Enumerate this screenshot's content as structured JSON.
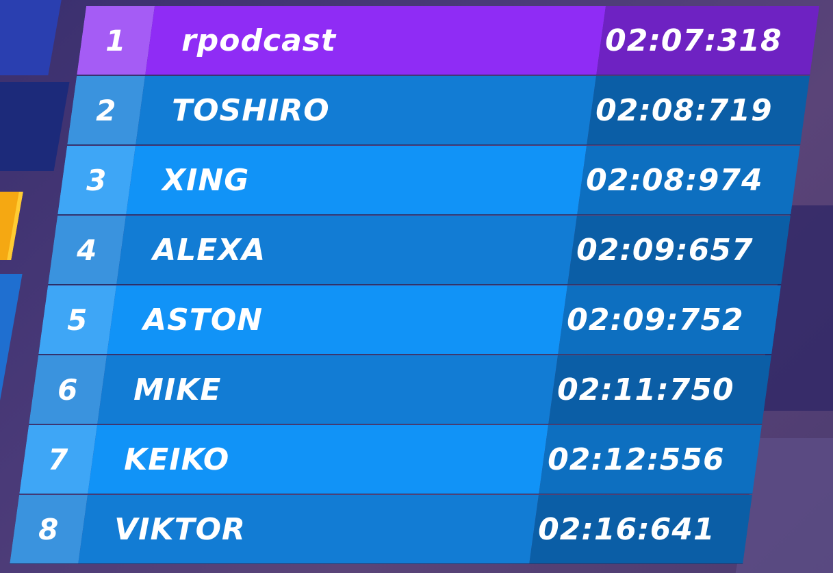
{
  "leaderboard": {
    "rows": [
      {
        "rank": "1",
        "name": "rpodcast",
        "time": "02:07:318",
        "highlight": true
      },
      {
        "rank": "2",
        "name": "TOSHIRO",
        "time": "02:08:719"
      },
      {
        "rank": "3",
        "name": "XING",
        "time": "02:08:974"
      },
      {
        "rank": "4",
        "name": "ALEXA",
        "time": "02:09:657"
      },
      {
        "rank": "5",
        "name": "ASTON",
        "time": "02:09:752"
      },
      {
        "rank": "6",
        "name": "MIKE",
        "time": "02:11:750"
      },
      {
        "rank": "7",
        "name": "KEIKO",
        "time": "02:12:556"
      },
      {
        "rank": "8",
        "name": "VIKTOR",
        "time": "02:16:641"
      }
    ]
  },
  "colors": {
    "highlight_row": "#8f2cf5",
    "row_dark": "#127cd4",
    "row_light": "#1193f7",
    "time_cell": "#0b5ea6",
    "text": "#ffffff"
  }
}
